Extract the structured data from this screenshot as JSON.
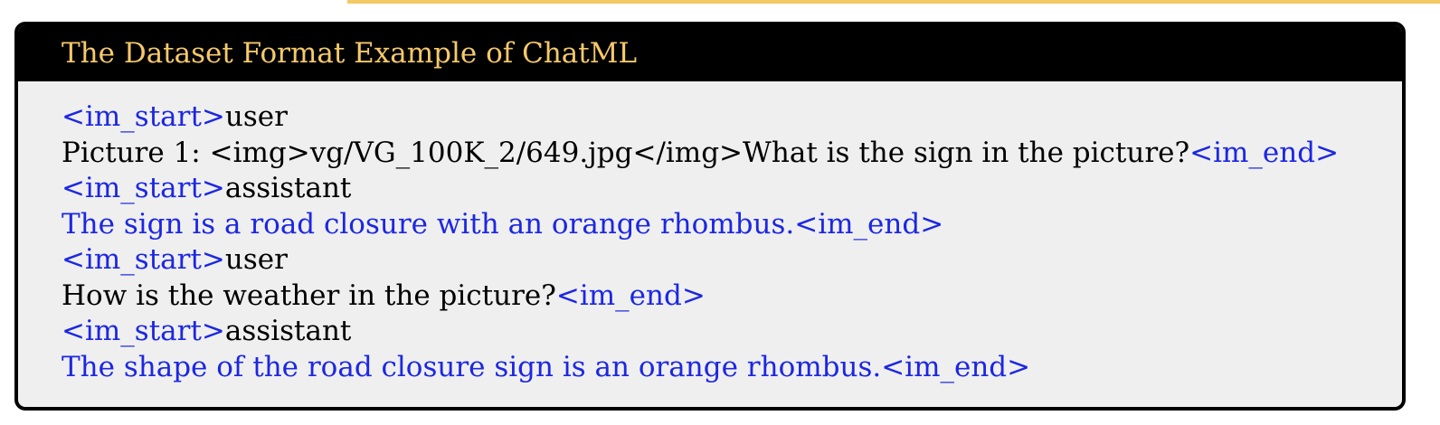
{
  "page": {
    "title": "The Dataset Format Example of ChatML",
    "accent_color": "#f6c96a",
    "token_color": "#1c27e2",
    "text_color": "#000000",
    "body_background": "#efefef"
  },
  "lines": [
    {
      "token": "<im_start>",
      "text": "user"
    },
    {
      "text": "Picture 1: <img>vg/VG_100K_2/649.jpg</img>What is the sign in the picture?",
      "token": "<im_end>"
    },
    {
      "token": "<im_start>",
      "text": "assistant"
    },
    {
      "response": "The sign is a road closure with an orange rhombus.<im_end>"
    },
    {
      "token": "<im_start>",
      "text": "user"
    },
    {
      "text": "How is the weather in the picture?",
      "token": "<im_end>"
    },
    {
      "token": "<im_start>",
      "text": "assistant"
    },
    {
      "response": "The shape of the road closure sign is an orange rhombus.<im_end>"
    }
  ]
}
